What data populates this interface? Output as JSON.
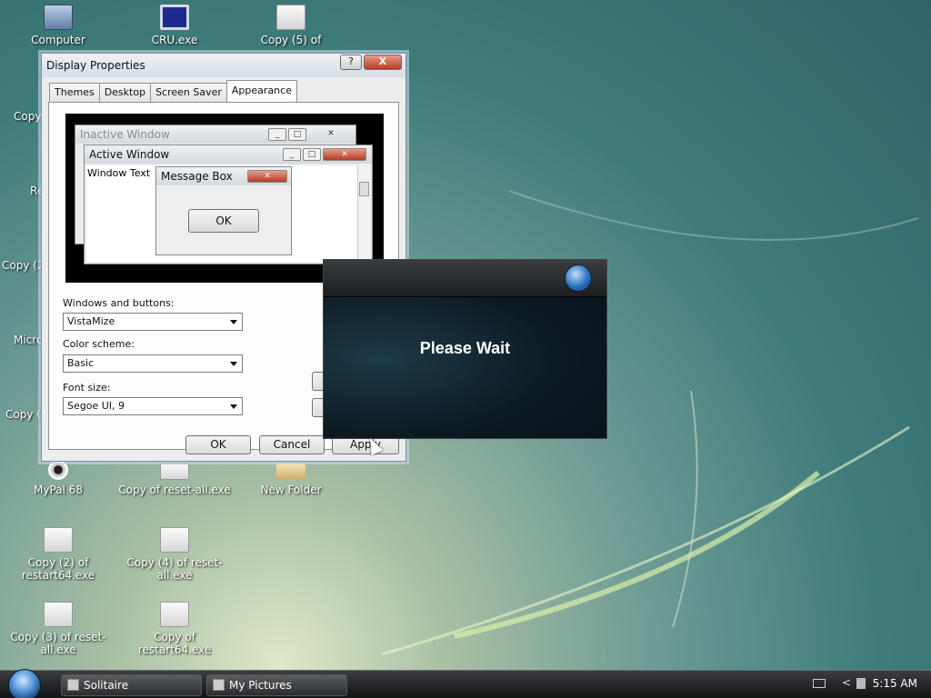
{
  "desktop": {
    "icons": [
      {
        "label": "Computer",
        "icon": "computer-icon"
      },
      {
        "label": "CRU.exe",
        "icon": "monitor-icon"
      },
      {
        "label": "Copy (5) of",
        "icon": "file-icon"
      },
      {
        "label": "MyPal 68",
        "icon": "pal-icon"
      },
      {
        "label": "Copy of reset-all.exe",
        "icon": "file-icon"
      },
      {
        "label": "New Folder",
        "icon": "folder-icon"
      },
      {
        "label": "Copy (2) of restart64.exe",
        "icon": "file-icon"
      },
      {
        "label": "Copy (4) of reset-all.exe",
        "icon": "file-icon"
      },
      {
        "label": "Copy (3) of reset-all.exe",
        "icon": "file-icon"
      },
      {
        "label": "Copy of restart64.exe",
        "icon": "file-icon"
      }
    ],
    "partial_labels": [
      "Copy",
      "Re",
      "Copy (2",
      "Micro",
      "Copy ("
    ]
  },
  "dialog": {
    "title": "Display Properties",
    "help_label": "?",
    "close_label": "X",
    "tabs": [
      "Themes",
      "Desktop",
      "Screen Saver",
      "Appearance"
    ],
    "active_tab": "Appearance",
    "preview": {
      "inactive_title": "Inactive Window",
      "active_title": "Active Window",
      "window_text": "Window Text",
      "message_title": "Message Box",
      "ok_label": "OK"
    },
    "windows_buttons_label": "Windows and buttons:",
    "windows_buttons_value": "VistaMize",
    "color_scheme_label": "Color scheme:",
    "color_scheme_value": "Basic",
    "font_size_label": "Font size:",
    "font_size_value": "Segoe UI, 9",
    "ok_label": "OK",
    "cancel_label": "Cancel",
    "apply_label": "Apply"
  },
  "overlay": {
    "message": "Please Wait"
  },
  "taskbar": {
    "tasks": [
      "Solitaire",
      "My Pictures"
    ],
    "tray_arrow": "<",
    "clock": "5:15 AM"
  }
}
